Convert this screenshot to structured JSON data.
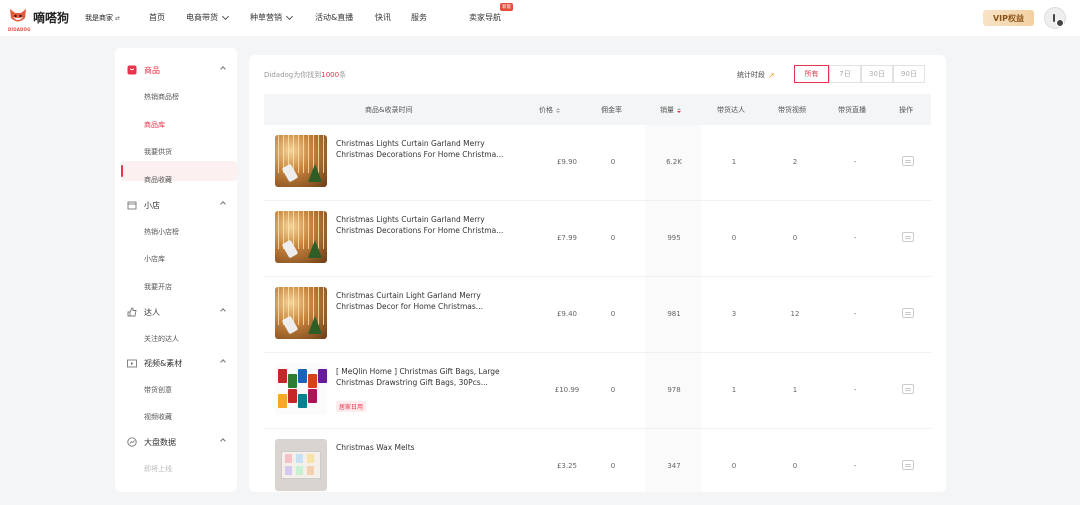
{
  "header": {
    "logo_text": "嘀嗒狗",
    "logo_sub": "DIDADOG",
    "seller_switch": "我是商家",
    "nav": [
      {
        "label": "首页",
        "has_menu": false
      },
      {
        "label": "电商带货",
        "has_menu": true
      },
      {
        "label": "种草营销",
        "has_menu": true
      },
      {
        "label": "活动&直播",
        "has_menu": false
      },
      {
        "label": "快讯",
        "has_menu": false
      },
      {
        "label": "服务",
        "has_menu": false
      },
      {
        "label": "卖家导航",
        "has_menu": false,
        "badge": "新版"
      }
    ],
    "vip_label": "VIP权益"
  },
  "sidebar": {
    "sections": [
      {
        "label": "商品",
        "icon": "shopping-bag-icon",
        "items": [
          "热销商品榜",
          "商品库",
          "我要供货",
          "商品收藏"
        ]
      },
      {
        "label": "小店",
        "icon": "store-icon",
        "items": [
          "热销小店榜",
          "小店库",
          "我要开店"
        ]
      },
      {
        "label": "达人",
        "icon": "thumbs-up-icon",
        "items": [
          "关注的达人"
        ]
      },
      {
        "label": "视频&素材",
        "icon": "video-icon",
        "items": [
          "带货创意",
          "视频收藏"
        ]
      },
      {
        "label": "大盘数据",
        "icon": "chart-icon",
        "items": [
          "即将上线"
        ]
      }
    ],
    "active_item": "商品库"
  },
  "main": {
    "count_prefix": "Didadog为你找到",
    "count_value": "1000",
    "count_suffix": "条",
    "stat_label": "统计时段",
    "periods": [
      "所有",
      "7日",
      "30日",
      "90日"
    ],
    "active_period": "所有",
    "columns": [
      "商品&收录时间",
      "价格",
      "佣金率",
      "销量",
      "带货达人",
      "带货视频",
      "带货直播",
      "操作"
    ],
    "rows": [
      {
        "title": "Christmas Lights Curtain Garland Merry Christmas Decorations For Home Christma...",
        "price": "£9.90",
        "commission": "0",
        "sales": "6.2K",
        "creators": "1",
        "videos": "2",
        "lives": "-",
        "thumb": "lights",
        "tag": ""
      },
      {
        "title": "Christmas Lights Curtain Garland Merry Christmas Decorations For Home Christma...",
        "price": "£7.99",
        "commission": "0",
        "sales": "995",
        "creators": "0",
        "videos": "0",
        "lives": "-",
        "thumb": "lights",
        "tag": ""
      },
      {
        "title": "Christmas Curtain Light Garland Merry Christmas Decor for Home Christmas...",
        "price": "£9.40",
        "commission": "0",
        "sales": "981",
        "creators": "3",
        "videos": "12",
        "lives": "-",
        "thumb": "lights",
        "tag": ""
      },
      {
        "title": "[ MeQlin Home ] Christmas Gift Bags, Large Christmas Drawstring Gift Bags, 30Pcs...",
        "price": "£10.99",
        "commission": "0",
        "sales": "978",
        "creators": "1",
        "videos": "1",
        "lives": "-",
        "thumb": "gifts",
        "tag": "居家日用"
      },
      {
        "title": "Christmas Wax Melts",
        "price": "£3.25",
        "commission": "0",
        "sales": "347",
        "creators": "0",
        "videos": "0",
        "lives": "-",
        "thumb": "wax",
        "tag": ""
      }
    ]
  },
  "colors": {
    "accent": "#e8334a",
    "vip_text": "#8a5418",
    "background": "#f4f5f7"
  }
}
